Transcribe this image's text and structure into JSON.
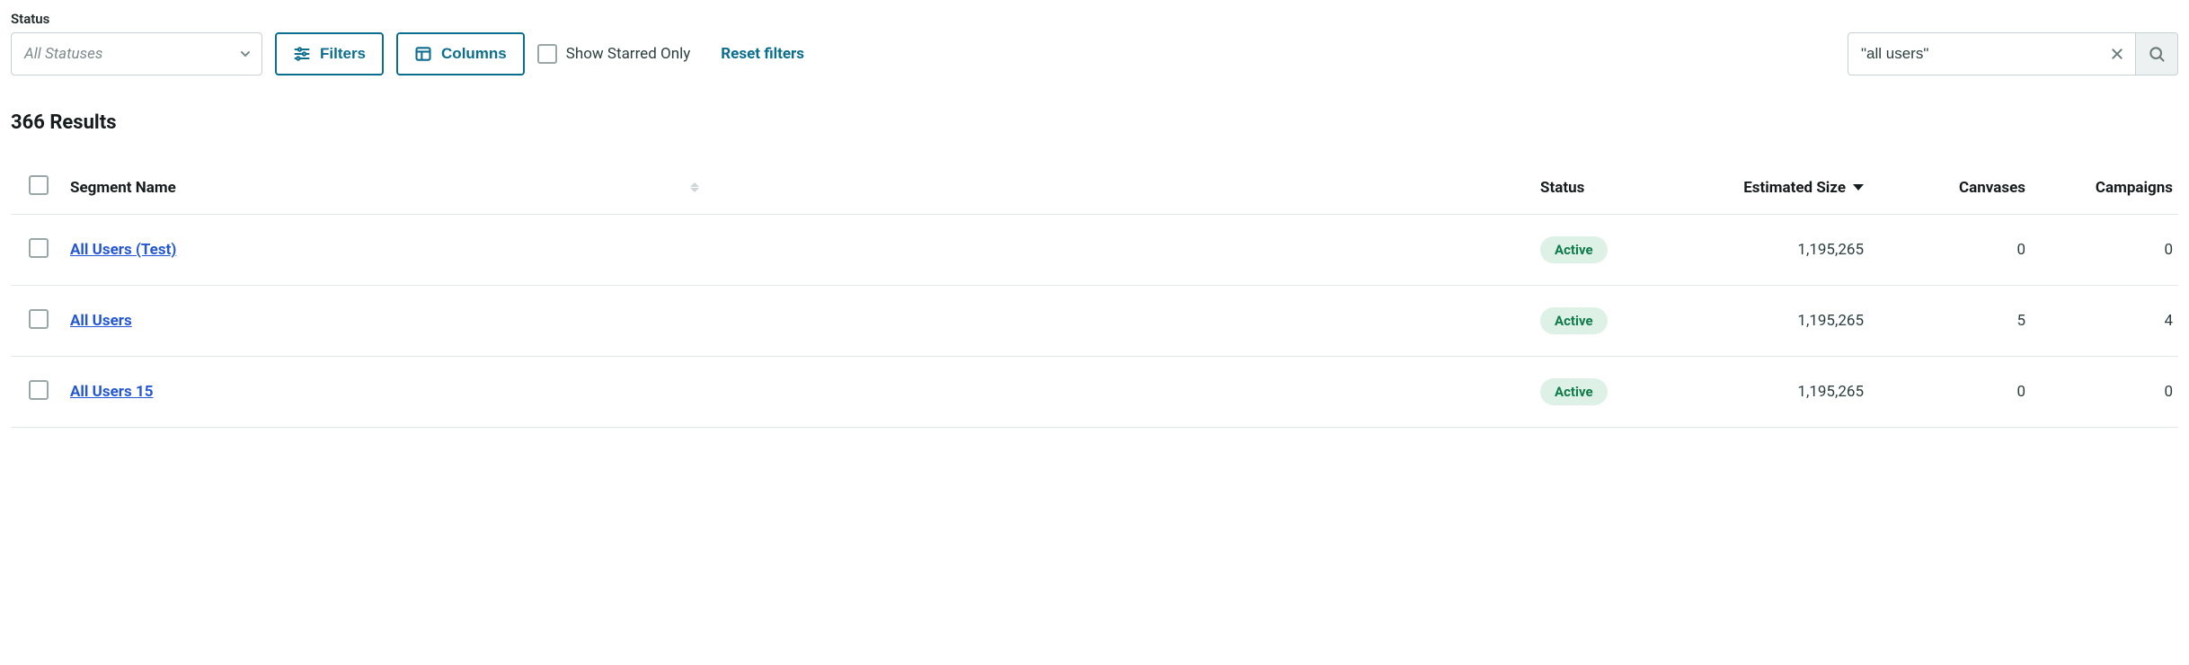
{
  "filters": {
    "status_label": "Status",
    "status_placeholder": "All Statuses",
    "filters_label": "Filters",
    "columns_label": "Columns",
    "starred_label": "Show Starred Only",
    "reset_label": "Reset filters"
  },
  "search": {
    "value": "\"all users\""
  },
  "results": {
    "count_text": "366 Results"
  },
  "table": {
    "headers": {
      "segment_name": "Segment Name",
      "status": "Status",
      "estimated_size": "Estimated Size",
      "canvases": "Canvases",
      "campaigns": "Campaigns"
    },
    "rows": [
      {
        "name": "All Users (Test)",
        "status": "Active",
        "estimated_size": "1,195,265",
        "canvases": "0",
        "campaigns": "0"
      },
      {
        "name": "All Users",
        "status": "Active",
        "estimated_size": "1,195,265",
        "canvases": "5",
        "campaigns": "4"
      },
      {
        "name": "All Users 15",
        "status": "Active",
        "estimated_size": "1,195,265",
        "canvases": "0",
        "campaigns": "0"
      }
    ]
  }
}
